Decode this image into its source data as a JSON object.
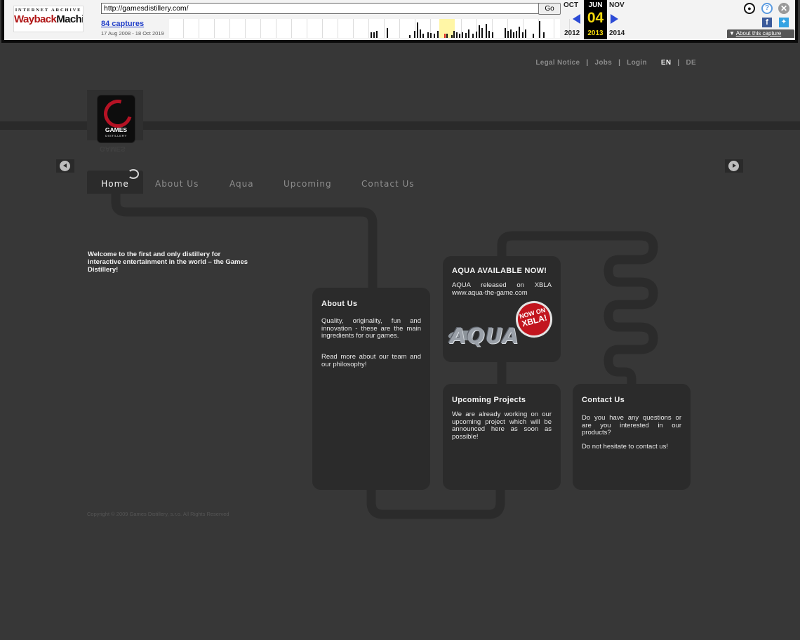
{
  "wayback": {
    "logo_top": "INTERNET ARCHIVE",
    "logo_main_a": "Wayback",
    "logo_main_b": "Machine",
    "url": "http://gamesdistillery.com/",
    "go_label": "Go",
    "captures": "84 captures",
    "date_range": "17 Aug 2008 - 18 Oct 2019",
    "prev_month": "OCT",
    "cur_month": "JUN",
    "next_month": "NOV",
    "cur_day": "04",
    "prev_year": "2012",
    "cur_year": "2013",
    "next_year": "2014",
    "about_capture": "About this capture",
    "icons": {
      "user": "user-icon",
      "help": "help-icon",
      "close": "close-icon",
      "facebook": "facebook-icon",
      "twitter": "twitter-icon"
    },
    "accent_color": "#2c4bd6"
  },
  "site": {
    "topnav": {
      "legal": "Legal Notice",
      "jobs": "Jobs",
      "login": "Login",
      "sep": "|",
      "lang_en": "EN",
      "lang_de": "DE"
    },
    "logo": {
      "name": "GAMES",
      "sub": "DISTILLERY"
    },
    "nav": {
      "home": "Home",
      "about": "About Us",
      "aqua": "Aqua",
      "upcoming": "Upcoming",
      "contact": "Contact Us"
    },
    "welcome": "Welcome to the first and only distillery for interactive entertainment in the world – the Games Distillery!",
    "boxes": {
      "about": {
        "title": "About Us",
        "p1": "Quality, originality, fun and innovation - these are the main ingredients for our games.",
        "p2": "Read more about our team and our philosophy!"
      },
      "aqua": {
        "title": "AQUA AVAILABLE NOW!",
        "p1": "AQUA released on XBLA www.aqua-the-game.com",
        "logo": "AQUA",
        "badge_1": "NOW ON",
        "badge_2": "XBLA!"
      },
      "upcoming": {
        "title": "Upcoming Projects",
        "p1": "We are already working on our upcoming project which will be announced here as soon as possible!"
      },
      "contact": {
        "title": "Contact Us",
        "p1": "Do you have any questions or are you interested in our products?",
        "p2": "Do not hesitate to contact us!"
      }
    },
    "copyright": "Copyright © 2009 Games Distillery, s.r.o. All Rights Reserved",
    "colors": {
      "background": "#373737",
      "panel": "#2b2b2b",
      "brand_red": "#b51224"
    }
  }
}
